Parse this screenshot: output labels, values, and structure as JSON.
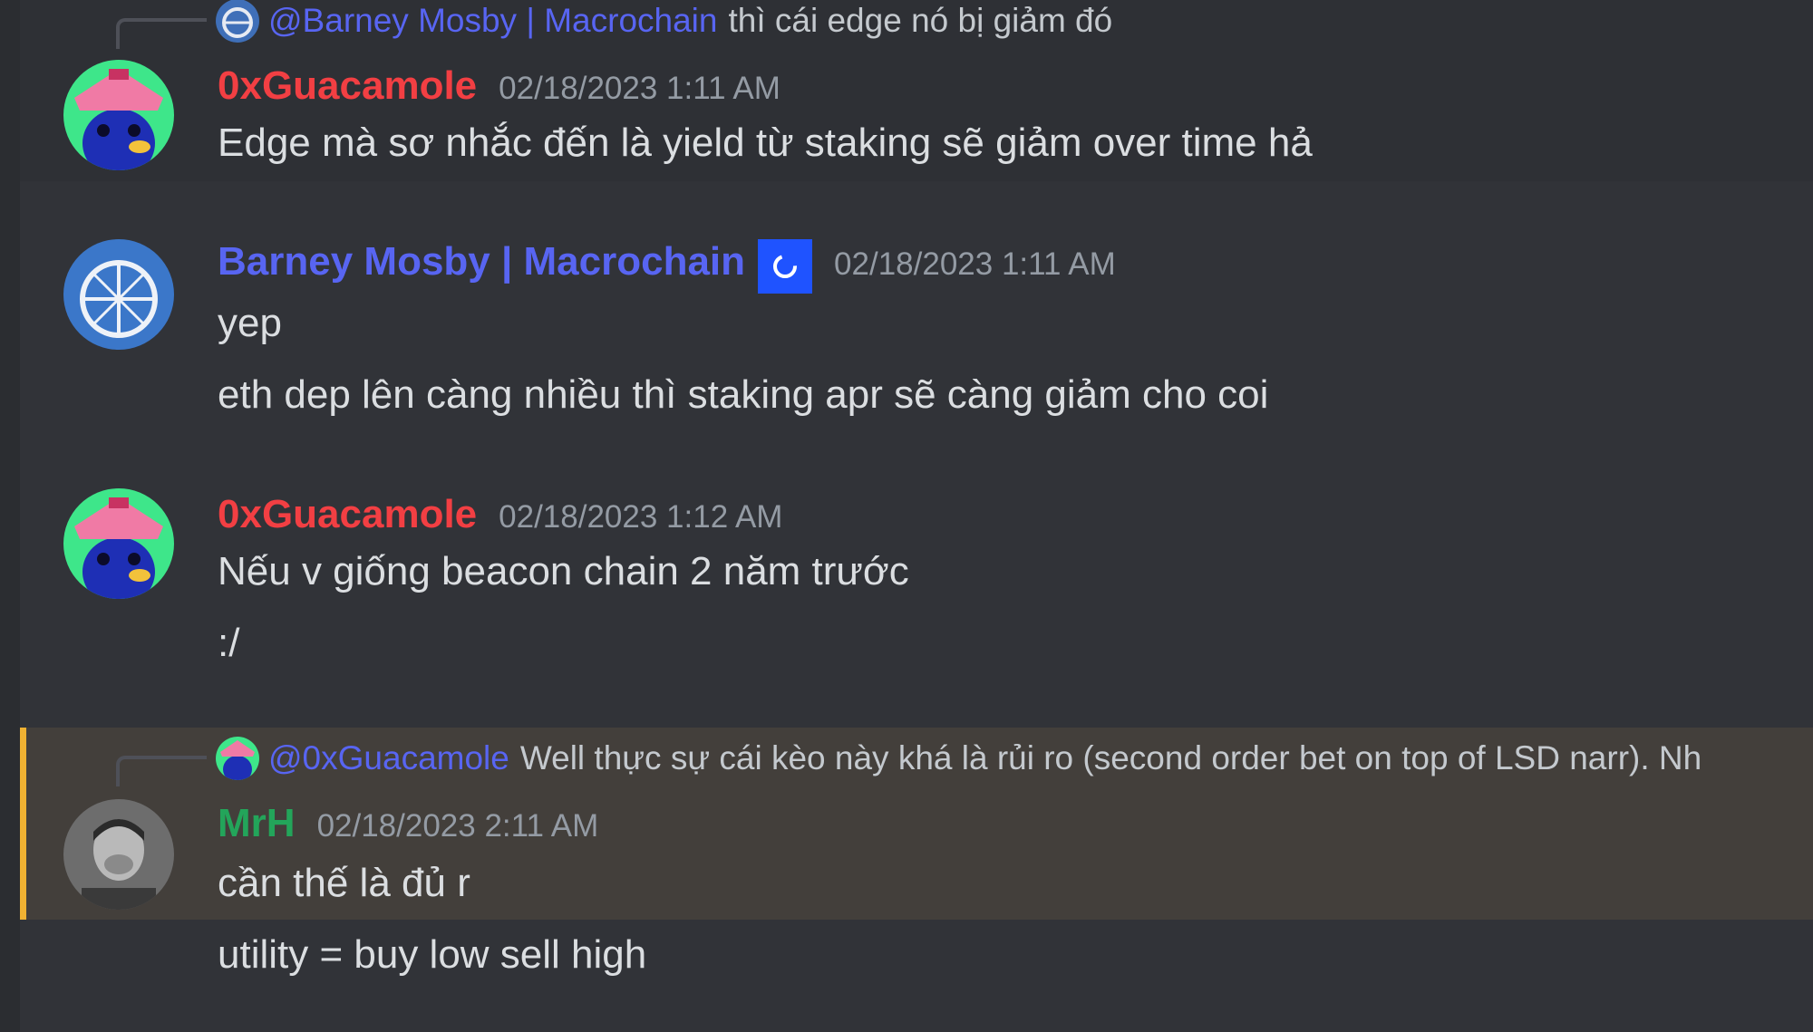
{
  "colors": {
    "background": "#313338",
    "mention": "#5865f2",
    "user_red": "#f23f43",
    "user_blue": "#5865f2",
    "user_green": "#23a55a",
    "highlight_bg": "#433f3b",
    "highlight_bar": "#f0b232"
  },
  "messages": [
    {
      "reply": {
        "mention": "@Barney Mosby | Macrochain",
        "text": "thì cái edge nó bị giảm đó"
      },
      "username": "0xGuacamole",
      "timestamp": "02/18/2023 1:11 AM",
      "lines": [
        "Edge mà sơ nhắc đến là yield từ staking sẽ giảm over time hả"
      ]
    },
    {
      "username": "Barney Mosby | Macrochain",
      "role_icon": "role-badge-icon",
      "timestamp": "02/18/2023 1:11 AM",
      "lines": [
        "yep",
        "eth dep lên càng nhiều thì staking apr sẽ càng giảm cho coi"
      ]
    },
    {
      "username": "0xGuacamole",
      "timestamp": "02/18/2023 1:12 AM",
      "lines": [
        "Nếu v giống beacon chain 2 năm trước",
        ":/"
      ]
    },
    {
      "reply": {
        "mention": "@0xGuacamole",
        "text": "Well thực sự cái kèo này khá là rủi ro (second order bet on top of LSD narr). Nh"
      },
      "username": "MrH",
      "timestamp": "02/18/2023 2:11 AM",
      "lines": [
        "cần thế là đủ r",
        "utility = buy low sell high"
      ]
    }
  ]
}
